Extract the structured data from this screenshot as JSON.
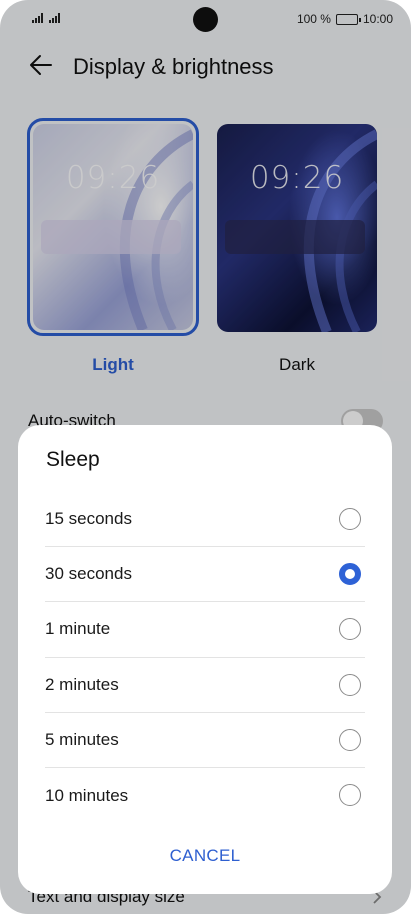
{
  "status_bar": {
    "battery_text": "100 %",
    "time": "10:00"
  },
  "header": {
    "title": "Display & brightness"
  },
  "themes": {
    "light": {
      "label": "Light",
      "preview_time": "09:26",
      "selected": true
    },
    "dark": {
      "label": "Dark",
      "preview_time": "09:26",
      "selected": false
    }
  },
  "settings": {
    "auto_switch_label": "Auto-switch",
    "text_display_label": "Text and display size"
  },
  "dialog": {
    "title": "Sleep",
    "options": [
      {
        "label": "15 seconds",
        "selected": false
      },
      {
        "label": "30 seconds",
        "selected": true
      },
      {
        "label": "1 minute",
        "selected": false
      },
      {
        "label": "2 minutes",
        "selected": false
      },
      {
        "label": "5 minutes",
        "selected": false
      },
      {
        "label": "10 minutes",
        "selected": false
      }
    ],
    "cancel_label": "CANCEL"
  },
  "colors": {
    "accent": "#2e5fd0",
    "radio_selected": "#2e62d6"
  },
  "icons": {
    "back": "arrow-left-icon",
    "chevron": "chevron-right-icon"
  }
}
